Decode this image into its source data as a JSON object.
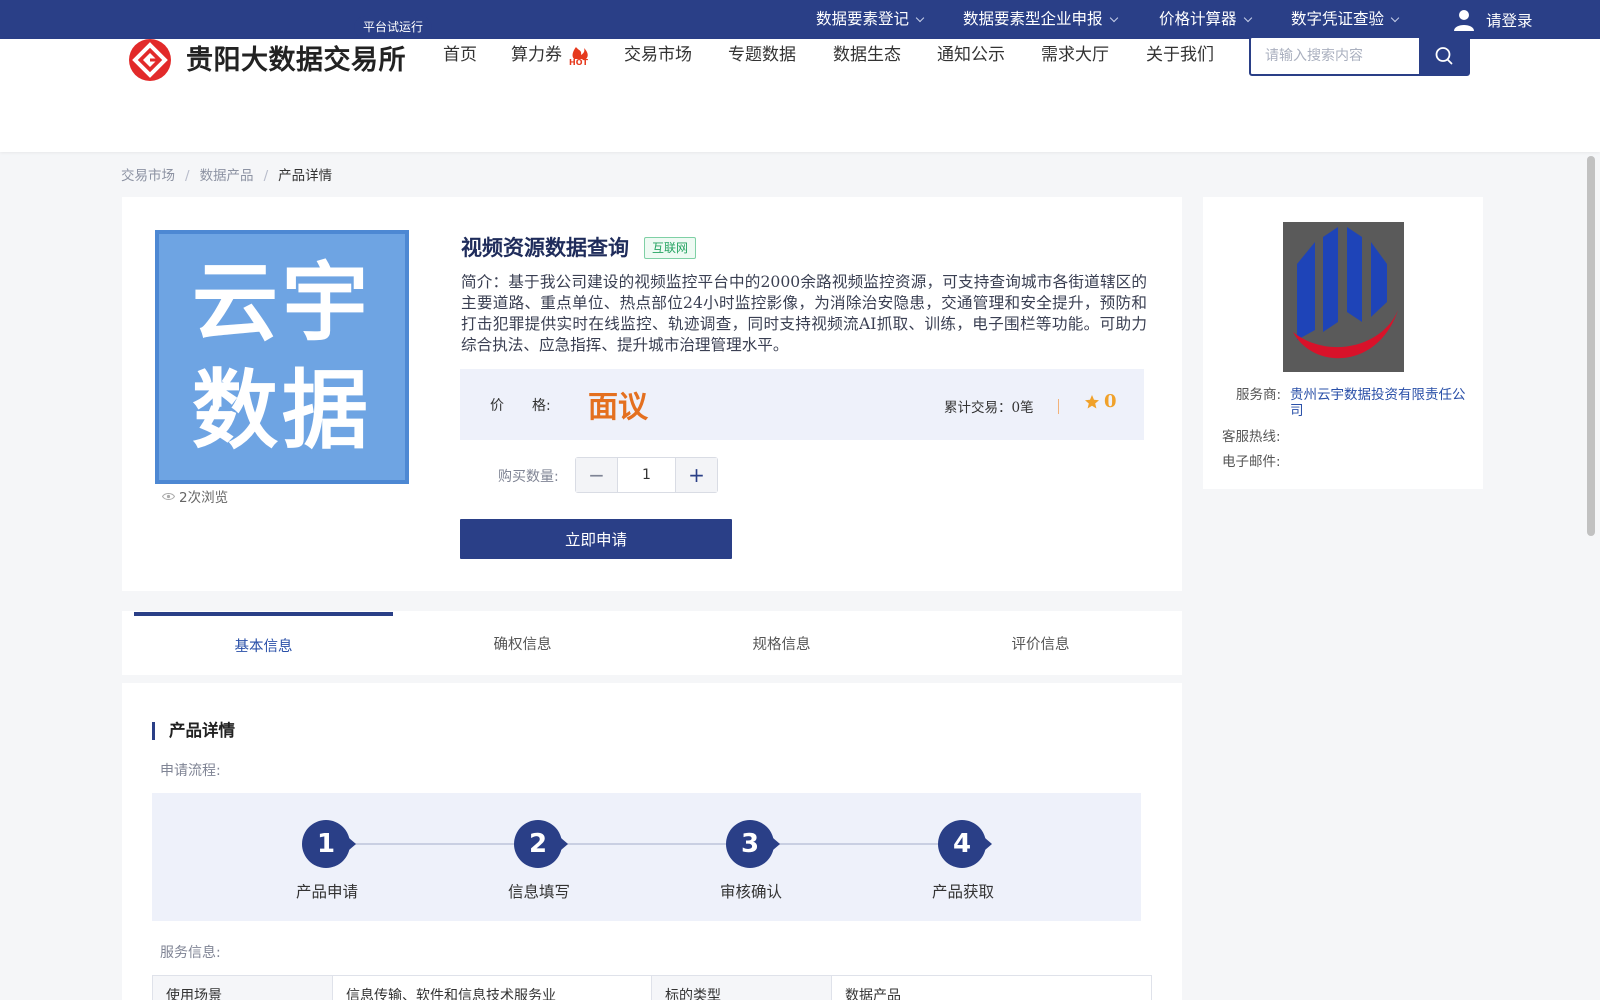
{
  "topbar": {
    "items": [
      "数据要素登记",
      "数据要素型企业申报",
      "价格计算器",
      "数字凭证查验"
    ],
    "login_label": "请登录"
  },
  "header": {
    "logo_text": "贵阳大数据交易所",
    "trial_badge": "平台试运行",
    "nav": [
      "首页",
      "算力券",
      "交易市场",
      "专题数据",
      "数据生态",
      "通知公示",
      "需求大厅",
      "关于我们"
    ],
    "hot_badge": "HOT",
    "search_placeholder": "请输入搜索内容"
  },
  "breadcrumb": [
    "交易市场",
    "数据产品",
    "产品详情"
  ],
  "product": {
    "image_text": [
      "云宇",
      "数据"
    ],
    "views": "2次浏览",
    "title": "视频资源数据查询",
    "tag": "互联网",
    "intro": "简介：基于我公司建设的视频监控平台中的2000余路视频监控资源，可支持查询城市各街道辖区的主要道路、重点单位、热点部位24小时监控影像，为消除治安隐患，交通管理和安全提升，预防和打击犯罪提供实时在线监控、轨迹调查，同时支持视频流AI抓取、训练，电子围栏等功能。可助力综合执法、应急指挥、提升城市治理管理水平。",
    "price_label_a": "价",
    "price_label_b": "格:",
    "price_value": "面议",
    "trades_label": "累计交易：",
    "trades_value": "0笔",
    "rating": "0",
    "qty_label": "购买数量:",
    "qty_minus": "−",
    "qty_value": "1",
    "qty_plus": "+",
    "apply_label": "立即申请"
  },
  "vendor": {
    "provider_label": "服务商:",
    "provider_value": "贵州云宇数据投资有限责任公司",
    "hotline_label": "客服热线:",
    "email_label": "电子邮件:"
  },
  "tabs": [
    "基本信息",
    "确权信息",
    "规格信息",
    "评价信息"
  ],
  "details": {
    "section_title": "产品详情",
    "flow_label": "申请流程:",
    "steps": [
      {
        "num": "1",
        "label": "产品申请"
      },
      {
        "num": "2",
        "label": "信息填写"
      },
      {
        "num": "3",
        "label": "审核确认"
      },
      {
        "num": "4",
        "label": "产品获取"
      }
    ],
    "service_label": "服务信息:",
    "table": [
      [
        "使用场景",
        "信息传输、软件和信息技术服务业",
        "标的类型",
        "数据产品"
      ]
    ]
  },
  "colors": {
    "brand": "#2a3f87",
    "price": "#e4701f",
    "rating": "#f0a12a",
    "tag_green": "#25a362"
  }
}
